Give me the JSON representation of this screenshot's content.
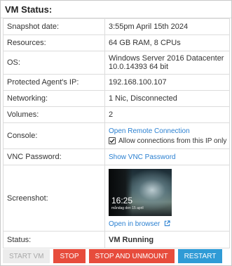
{
  "panel": {
    "title": "VM Status:"
  },
  "rows": {
    "snapshot_date": {
      "label": "Snapshot date:",
      "value": "3:55pm April 15th 2024"
    },
    "resources": {
      "label": "Resources:",
      "value": "64 GB RAM, 8 CPUs"
    },
    "os": {
      "label": "OS:",
      "value_line1": "Windows Server 2016 Datacenter",
      "value_line2": "10.0.14393 64 bit"
    },
    "protected_ip": {
      "label": "Protected Agent's IP:",
      "value": "192.168.100.107"
    },
    "networking": {
      "label": "Networking:",
      "value": "1 Nic, Disconnected"
    },
    "volumes": {
      "label": "Volumes:",
      "value": "2"
    },
    "console": {
      "label": "Console:",
      "link": "Open Remote Connection",
      "checkbox_label": "Allow connections from this IP only",
      "checkbox_checked": true
    },
    "vnc_password": {
      "label": "VNC Password:",
      "link": "Show VNC Password"
    },
    "screenshot": {
      "label": "Screenshot:",
      "lock_time": "16:25",
      "lock_date": "måndag den 15 april",
      "link": "Open in browser"
    },
    "status": {
      "label": "Status:",
      "value": "VM Running"
    }
  },
  "buttons": {
    "start": "START VM",
    "stop": "STOP",
    "stop_unmount": "STOP AND UNMOUNT",
    "restart": "RESTART"
  },
  "icons": {
    "checkbox": "checkmark-icon",
    "external": "external-link-icon"
  },
  "colors": {
    "link": "#2b80d1",
    "danger": "#e74c3c",
    "primary": "#2f9bd6",
    "disabled": "#ececec"
  }
}
